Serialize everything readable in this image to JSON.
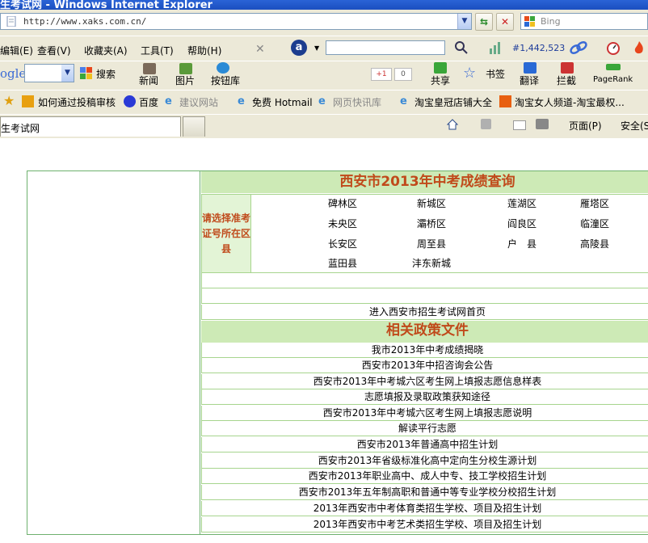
{
  "window": {
    "title": "生考试网 - Windows Internet Explorer"
  },
  "address": {
    "url": "http://www.xaks.com.cn/",
    "search_placeholder": "Bing"
  },
  "menu": {
    "items": [
      "编辑(E)",
      "查看(V)",
      "收藏夹(A)",
      "工具(T)",
      "帮助(H)"
    ],
    "rank_count": "#1,442,523"
  },
  "google_toolbar": {
    "logo": "ogle",
    "search_label": "搜索",
    "news_label": "新闻",
    "images_label": "图片",
    "buttons_label": "按钮库",
    "plusone_label": "+1",
    "plusone_count": "0",
    "share_label": "共享",
    "bookmarks_label": "书签",
    "translate_label": "翻译",
    "block_label": "拦截",
    "pagerank_label": "PageRank"
  },
  "favorites": [
    "如何通过投稿审核",
    "百度",
    "建议网站",
    "免费 Hotmail",
    "网页快讯库",
    "淘宝皇冠店铺大全",
    "淘宝女人频道-淘宝最权..."
  ],
  "tab": {
    "title": "生考试网"
  },
  "command_bar": {
    "page_label": "页面(P)",
    "safety_label": "安全(S)"
  },
  "content": {
    "query_title": "西安市2013年中考成绩查询",
    "select_label": "请选择准考证号所在区县",
    "districts": [
      "碑林区",
      "新城区",
      "莲湖区",
      "雁塔区",
      "未央区",
      "灞桥区",
      "阎良区",
      "临潼区",
      "长安区",
      "周至县",
      "户　县",
      "高陵县",
      "蓝田县",
      "沣东新城"
    ],
    "home_link": "进入西安市招生考试网首页",
    "policy_title": "相关政策文件",
    "policy_links": [
      "我市2013年中考成绩揭晓",
      "西安市2013年中招咨询会公告",
      "西安市2013年中考城六区考生网上填报志愿信息样表",
      "志愿填报及录取政策获知途径",
      "西安市2013年中考城六区考生网上填报志愿说明",
      "解读平行志愿",
      "西安市2013年普通高中招生计划",
      "西安市2013年省级标准化高中定向生分校生源计划",
      "西安市2013年职业高中、成人中专、技工学校招生计划",
      "西安市2013年五年制高职和普通中等专业学校分校招生计划",
      "2013年西安市中考体育类招生学校、项目及招生计划",
      "2013年西安市中考艺术类招生学校、项目及招生计划"
    ]
  },
  "colors": {
    "header_bg": "#cdeab6",
    "header_text": "#c04a1b",
    "border": "#6eb16e",
    "chrome": "#ece9d8"
  }
}
